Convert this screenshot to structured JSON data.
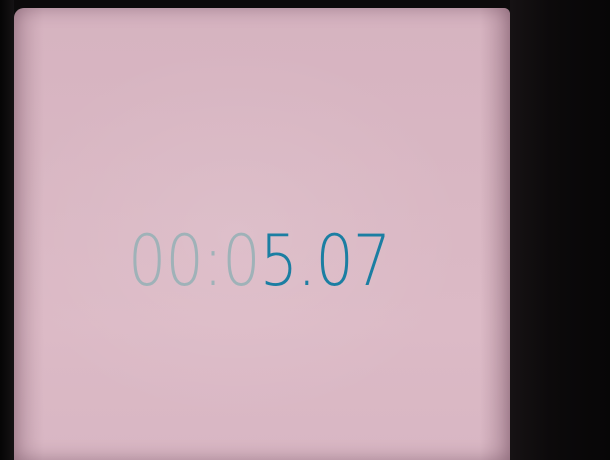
{
  "stopwatch": {
    "display": {
      "inactive_digits": "00:0",
      "active_digits": "5.07"
    },
    "colors": {
      "inactive": "#9fb2b8",
      "active": "#1b7ea2",
      "screen_background": "#d9b7c3"
    }
  }
}
